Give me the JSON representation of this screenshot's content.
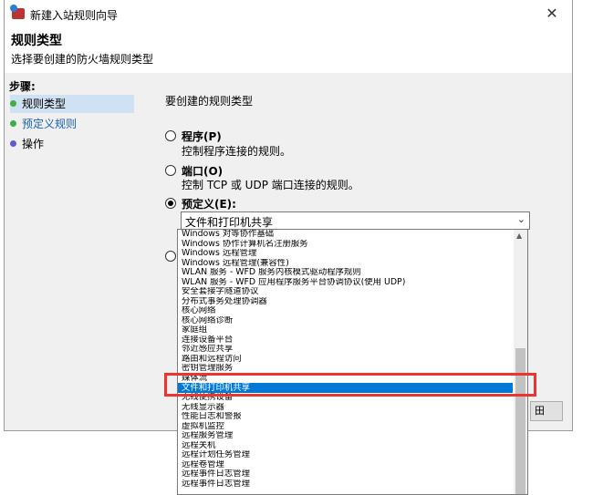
{
  "window": {
    "title": "新建入站规则向导",
    "close_glyph": "✕"
  },
  "header": {
    "title": "规则类型",
    "subtitle": "选择要创建的防火墙规则类型"
  },
  "steps": {
    "label": "步骤:",
    "items": [
      {
        "label": "规则类型",
        "dot_color": "#3cb043"
      },
      {
        "label": "预定义规则",
        "dot_color": "#3cb043"
      },
      {
        "label": "操作",
        "dot_color": "#5b5bd6"
      }
    ]
  },
  "content": {
    "prompt": "要创建的规则类型",
    "options": {
      "program": {
        "label": "程序(P)",
        "desc": "控制程序连接的规则。"
      },
      "port": {
        "label": "端口(O)",
        "desc": "控制 TCP 或 UDP 端口连接的规则。"
      },
      "predefined": {
        "label": "预定义(E):"
      }
    },
    "combo_value": "文件和打印机共享",
    "back_button_fragment": "田"
  },
  "dropdown": {
    "items": [
      "Windows 对等协作基础",
      "Windows 协作计算机名注册服务",
      "Windows 远程管理",
      "Windows 远程管理(兼容性)",
      "WLAN 服务 - WFD 服务内核模式驱动程序规则",
      "WLAN 服务 - WFD 应用程序服务平台协调协议(使用 UDP)",
      "安全套接字隧道协议",
      "分布式事务处理协调器",
      "核心网络",
      "核心网络诊断",
      "家庭组",
      "连接设备平台",
      "邻近感应共享",
      "路由和远程访问",
      "密钥管理服务",
      "媒体流",
      "文件和打印机共享",
      "无线便携设备",
      "无线显示器",
      "性能日志和警报",
      "虚拟机监控",
      "远程服务管理",
      "远程关机",
      "远程计划任务管理",
      "远程卷管理",
      "远程事件日志管理",
      "远程事件日志管理"
    ],
    "selected_index": 16
  }
}
